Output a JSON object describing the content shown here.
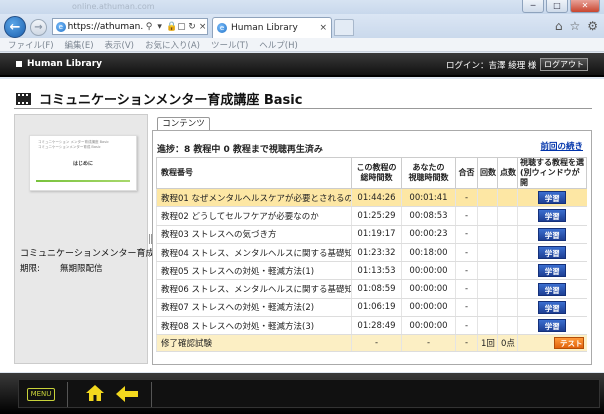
{
  "browser": {
    "ghost_url": "online.athuman.com",
    "url": "https://athuman.n",
    "tab_title": "Human Library",
    "window_buttons": [
      "─",
      "□",
      "✕"
    ],
    "menu": [
      "ファイル(F)",
      "編集(E)",
      "表示(V)",
      "お気に入り(A)",
      "ツール(T)",
      "ヘルプ(H)"
    ]
  },
  "header": {
    "brand": "Human Library",
    "login_text": "ログイン：吉澤 綾理 様",
    "logout_label": "ログアウト"
  },
  "course": {
    "title": "コミュニケーションメンター育成講座 Basic",
    "name_short": "コミュニケーションメンター育成講",
    "period_label": "期限:",
    "period_value": "無期限配信",
    "thumb_lines": [
      "コミュニケーション メンター育成講座 Basic",
      "コミュニケーションメンター育成 Basic",
      "はじめに"
    ],
    "thumb_heading": "はじめに"
  },
  "content": {
    "tab_label": "コンテンツ",
    "progress_text": "進捗：8 教程中 0 教程まで視聴再生済み",
    "prev_link": "前回の続き",
    "columns": {
      "name": "教程番号",
      "total_time": "この教程の\n総時間数",
      "your_time": "あなたの\n視聴時間数",
      "pass": "合否",
      "count": "回数",
      "score": "点数",
      "action": "視聴する教程を選\n(別ウィンドウが開"
    },
    "rows": [
      {
        "name": "教程01  なぜメンタルヘルスケアが必要とされるのか",
        "total": "01:44:26",
        "yours": "00:01:41",
        "pass": "-",
        "count": "",
        "score": "",
        "btn": "学習"
      },
      {
        "name": "教程02  どうしてセルフケアが必要なのか",
        "total": "01:25:29",
        "yours": "00:08:53",
        "pass": "-",
        "count": "",
        "score": "",
        "btn": "学習"
      },
      {
        "name": "教程03  ストレスへの気づき方",
        "total": "01:19:17",
        "yours": "00:00:23",
        "pass": "-",
        "count": "",
        "score": "",
        "btn": "学習"
      },
      {
        "name": "教程04  ストレス、メンタルヘルスに関する基礎知識(1)",
        "total": "01:23:32",
        "yours": "00:18:00",
        "pass": "-",
        "count": "",
        "score": "",
        "btn": "学習"
      },
      {
        "name": "教程05  ストレスへの対処・軽減方法(1)",
        "total": "01:13:53",
        "yours": "00:00:00",
        "pass": "-",
        "count": "",
        "score": "",
        "btn": "学習"
      },
      {
        "name": "教程06  ストレス、メンタルヘルスに関する基礎知識(2)",
        "total": "01:08:59",
        "yours": "00:00:00",
        "pass": "-",
        "count": "",
        "score": "",
        "btn": "学習"
      },
      {
        "name": "教程07  ストレスへの対処・軽減方法(2)",
        "total": "01:06:19",
        "yours": "00:00:00",
        "pass": "-",
        "count": "",
        "score": "",
        "btn": "学習"
      },
      {
        "name": "教程08  ストレスへの対処・軽減方法(3)",
        "total": "01:28:49",
        "yours": "00:00:00",
        "pass": "-",
        "count": "",
        "score": "",
        "btn": "学習"
      }
    ],
    "final_row": {
      "name": "修了確認試験",
      "total": "-",
      "yours": "-",
      "pass": "-",
      "count": "1回",
      "score": "0点",
      "btn": "テスト"
    }
  },
  "footer": {
    "menu_label": "MENU"
  },
  "colors": {
    "highlight_row": "#fde7a4",
    "study_button": "#1e3f94",
    "test_button": "#e0620c",
    "menu_accent": "#c8d23a"
  }
}
